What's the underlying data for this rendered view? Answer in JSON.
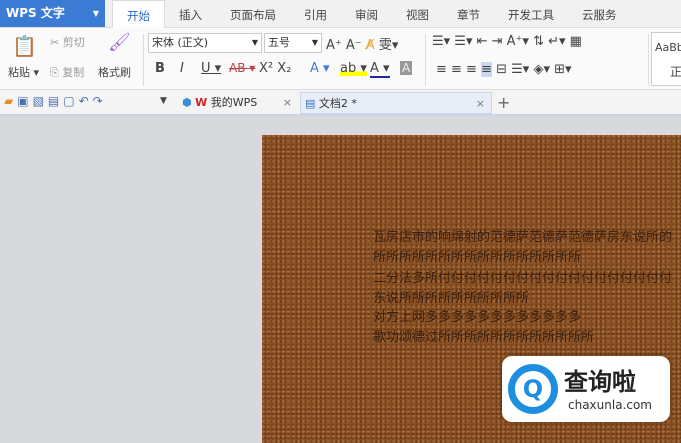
{
  "app": {
    "title": "WPS 文字"
  },
  "menu_tabs": [
    "开始",
    "插入",
    "页面布局",
    "引用",
    "审阅",
    "视图",
    "章节",
    "开发工具",
    "云服务"
  ],
  "ribbon": {
    "paste": "粘贴",
    "cut": "剪切",
    "copy": "复制",
    "format_painter": "格式刷",
    "font": "宋体 (正文)",
    "size": "五号",
    "style_preview": "AaBb",
    "style_name": "正"
  },
  "doc_tabs": [
    {
      "label": "我的WPS"
    },
    {
      "label": "文档2 *"
    }
  ],
  "document": {
    "lines": [
      "瓦房店市的响绵射的范德萨范德萨范德萨房东说所的",
      "所所所所所所所所所所所所所所所所",
      "二分法多所付付付付付付付付付付付付付付付付付付",
      "东说所所所所所所所所所所",
      "对方上网多多多多多多多多多多多多",
      "歌功颂德过所所所所所所所所所所所所"
    ]
  },
  "watermark": {
    "brand": "查询啦",
    "url": "chaxunla.com"
  },
  "colors": {
    "accent": "#3b7bd4",
    "page": "#8a4f22"
  }
}
